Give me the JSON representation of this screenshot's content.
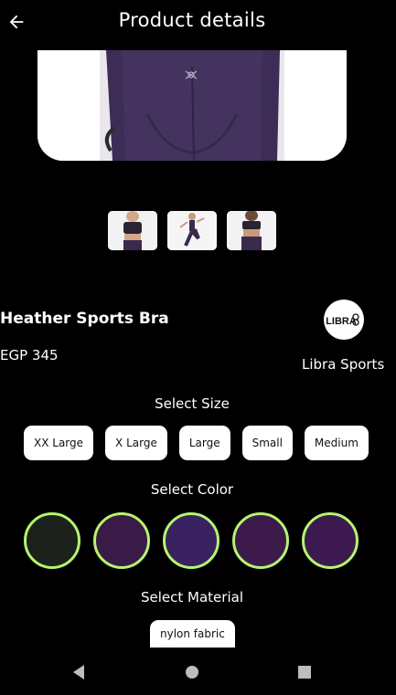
{
  "header": {
    "title": "Product details",
    "back_icon": "arrow-left-icon"
  },
  "gallery": {
    "thumbnails": [
      "front-view",
      "action-view",
      "back-view"
    ]
  },
  "product": {
    "name": "Heather Sports Bra",
    "price": "EGP 345"
  },
  "brand": {
    "name": "Libra Sports",
    "logo_text": "LIBRA"
  },
  "size": {
    "label": "Select Size",
    "options": [
      "XX Large",
      "X Large",
      "Large",
      "Small",
      "Medium"
    ]
  },
  "color": {
    "label": "Select Color",
    "swatches": [
      "#1c221b",
      "#3a1a47",
      "#3a2160",
      "#3d1a4c",
      "#3c1a4f",
      "#3a1a4c"
    ],
    "ring_color": "#b6f36f"
  },
  "material": {
    "label": "Select Material",
    "options": [
      "nylon fabric"
    ]
  },
  "nav": {
    "back_icon": "triangle-back-icon",
    "home_icon": "circle-home-icon",
    "recents_icon": "square-recents-icon"
  }
}
